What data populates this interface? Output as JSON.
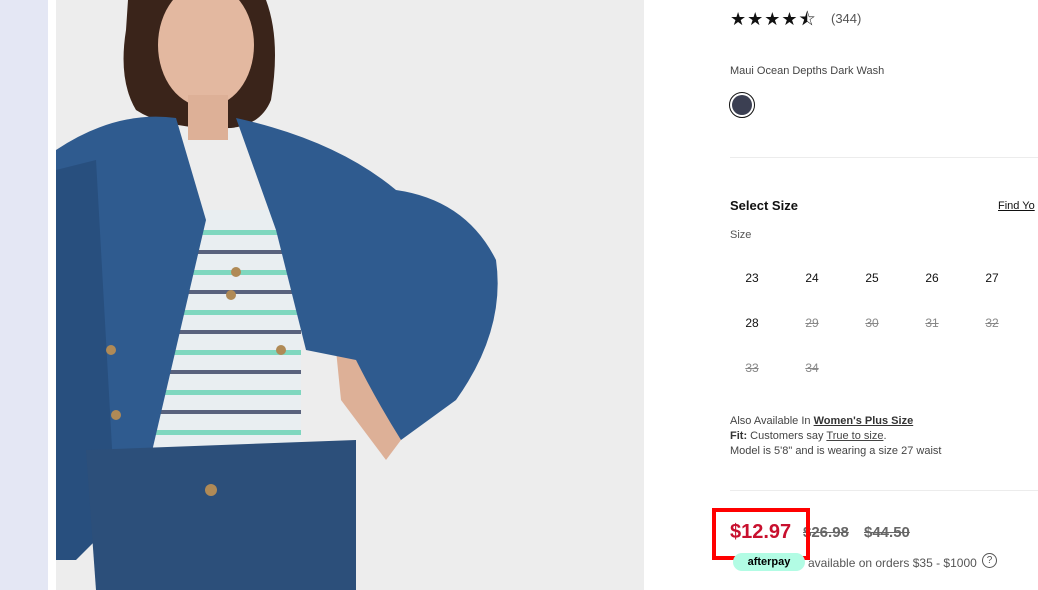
{
  "product": {
    "rating": {
      "stars": 4.5,
      "count_label": "(344)"
    },
    "color": {
      "name": "Maui Ocean Depths Dark Wash",
      "swatch_hex": "#3b3f52"
    },
    "size": {
      "heading": "Select Size",
      "find_link": "Find Yo",
      "label": "Size",
      "options": [
        {
          "label": "23",
          "available": true
        },
        {
          "label": "24",
          "available": true
        },
        {
          "label": "25",
          "available": true
        },
        {
          "label": "26",
          "available": true
        },
        {
          "label": "27",
          "available": true
        },
        {
          "label": "28",
          "available": true
        },
        {
          "label": "29",
          "available": false
        },
        {
          "label": "30",
          "available": false
        },
        {
          "label": "31",
          "available": false
        },
        {
          "label": "32",
          "available": false
        },
        {
          "label": "33",
          "available": false
        },
        {
          "label": "34",
          "available": false
        }
      ]
    },
    "info": {
      "also_available_prefix": "Also Available In ",
      "also_available_link": "Women's Plus Size",
      "fit_label": "Fit:",
      "fit_text": " Customers say ",
      "fit_link": "True to size",
      "fit_suffix": ".",
      "model_text": "Model is 5'8\" and is wearing a size 27 waist"
    },
    "price": {
      "sale": "$12.97",
      "was": "$26.98",
      "original": "$44.50",
      "sale_color": "#c8102e",
      "highlight_color": "#ff0000"
    },
    "afterpay": {
      "badge": "afterpay",
      "text": "available on orders $35 - $1000",
      "help_icon": "?"
    }
  }
}
